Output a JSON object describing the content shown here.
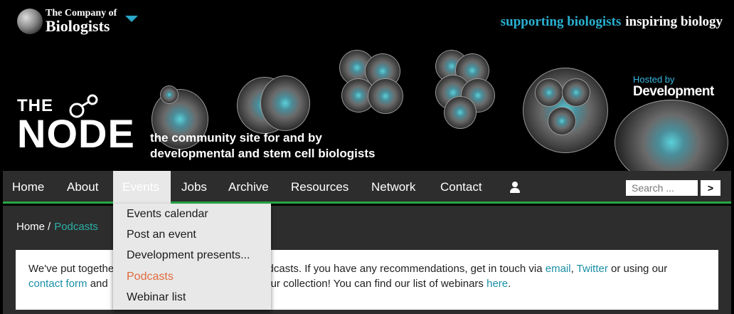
{
  "header": {
    "org_small": "The Company of",
    "org_big": "Biologists",
    "tagline_a": "supporting biologists",
    "tagline_b": "inspiring biology",
    "hosted_by": "Hosted by",
    "hosted_journal": "Development",
    "site_the": "THE",
    "site_name": "NODE",
    "site_sub_1": "the community site for and by",
    "site_sub_2": "developmental and stem cell biologists"
  },
  "nav": {
    "items": [
      {
        "label": "Home"
      },
      {
        "label": "About"
      },
      {
        "label": "Events"
      },
      {
        "label": "Jobs"
      },
      {
        "label": "Archive"
      },
      {
        "label": "Resources"
      },
      {
        "label": "Network"
      },
      {
        "label": "Contact"
      }
    ],
    "active_index": 2,
    "search_placeholder": "Search ...",
    "search_button": ">"
  },
  "dropdown": {
    "items": [
      {
        "label": "Events calendar"
      },
      {
        "label": "Post an event"
      },
      {
        "label": "Development presents..."
      },
      {
        "label": "Podcasts"
      },
      {
        "label": "Webinar list"
      }
    ],
    "active_index": 3
  },
  "breadcrumb": {
    "home": "Home",
    "separator": "/",
    "current": "Podcasts"
  },
  "intro": {
    "line1_start": "We've put togethe",
    "line1_end": "odcasts. If you have any recommendations, get in touch via",
    "email_link": "email",
    "comma": ",",
    "twitter_link": "Twitter",
    "line1_tail": "or using our",
    "contact_link": "contact form",
    "line2_mid": "and",
    "line2_end": "o our collection! You can find our list of webinars",
    "here_link": "here",
    "period": "."
  },
  "colors": {
    "accent_teal": "#2bb0a8",
    "nav_bg": "#2d2d2d",
    "nav_underline": "#27a845",
    "dropdown_active": "#e06a3c",
    "tagline_blue": "#2ab0d0"
  },
  "icons": {
    "user": "user-icon",
    "dropdown_caret": "chevron-down-icon"
  }
}
